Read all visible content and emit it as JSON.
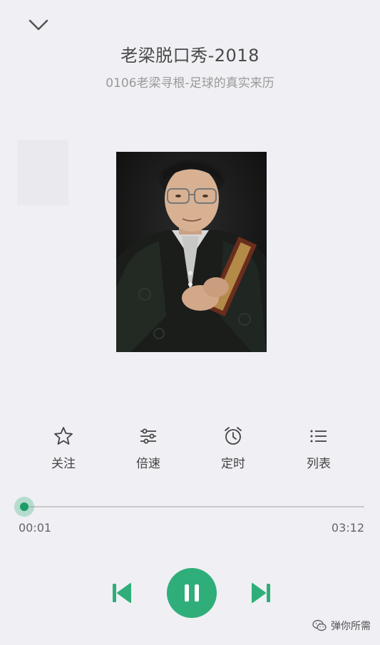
{
  "header": {
    "collapse_icon": "chevron-down-icon",
    "title": "老梁脱口秀-2018",
    "subtitle": "0106老梁寻根-足球的真实来历"
  },
  "cover": {
    "description_icon": "album-cover-portrait"
  },
  "actions": [
    {
      "label": "关注",
      "icon": "star-icon"
    },
    {
      "label": "倍速",
      "icon": "sliders-icon"
    },
    {
      "label": "定时",
      "icon": "alarm-clock-icon"
    },
    {
      "label": "列表",
      "icon": "list-icon"
    }
  ],
  "progress": {
    "current": "00:01",
    "total": "03:12",
    "fraction": 0.005
  },
  "controls": {
    "prev_icon": "skip-previous-icon",
    "play_pause_icon": "pause-icon",
    "next_icon": "skip-next-icon"
  },
  "watermark": {
    "text": "弹你所需",
    "icon": "wechat-icon"
  },
  "colors": {
    "accent": "#2fae79",
    "background": "#efeff4"
  }
}
